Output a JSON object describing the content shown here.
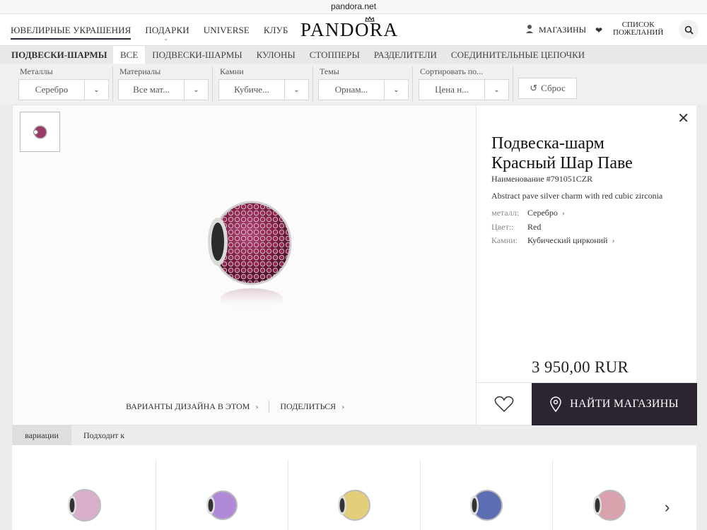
{
  "browser": {
    "url": "pandora.net"
  },
  "header": {
    "nav": [
      {
        "label": "ЮВЕЛИРНЫЕ УКРАШЕНИЯ"
      },
      {
        "label": "ПОДАРКИ"
      },
      {
        "label": "UNIVERSE"
      },
      {
        "label": "КЛУБ"
      }
    ],
    "logo": "PANDORA",
    "stores_label": "МАГАЗИНЫ",
    "wishlist_line1": "СПИСОК",
    "wishlist_line2": "ПОЖЕЛАНИЙ"
  },
  "category": {
    "title": "ПОДВЕСКИ-ШАРМЫ",
    "tabs": [
      {
        "label": "ВСЕ"
      },
      {
        "label": "ПОДВЕСКИ-ШАРМЫ"
      },
      {
        "label": "КУЛОНЫ"
      },
      {
        "label": "СТОППЕРЫ"
      },
      {
        "label": "РАЗДЕЛИТЕЛИ"
      },
      {
        "label": "СОЕДИНИТЕЛЬНЫЕ ЦЕПОЧКИ"
      }
    ]
  },
  "filters": [
    {
      "label": "Металлы",
      "value": "Серебро"
    },
    {
      "label": "Материалы",
      "value": "Все мат..."
    },
    {
      "label": "Камни",
      "value": "Кубиче..."
    },
    {
      "label": "Темы",
      "value": "Орнам..."
    },
    {
      "label": "Сортировать по...",
      "value": "Цена н..."
    }
  ],
  "reset_label": "Сброс",
  "product": {
    "title": "Подвеска-шарм Красный Шар Паве",
    "sku": "Наименование #791051CZR",
    "description": "Abstract pave silver charm with red cubic zirconia",
    "attributes": [
      {
        "key": "металл:",
        "value": "Серебро",
        "link": true
      },
      {
        "key": "Цвет::",
        "value": "Red",
        "link": false
      },
      {
        "key": "Камни:",
        "value": "Кубический цирконий",
        "link": true
      }
    ],
    "price": "3 950,00 RUR",
    "find_stores_label": "НАЙТИ МАГАЗИНЫ",
    "design_variants_label": "ВАРИАНТЫ ДИЗАЙНА В ЭТОМ",
    "share_label": "ПОДЕЛИТЬСЯ"
  },
  "variation_tabs": [
    {
      "label": "вариации"
    },
    {
      "label": "Подходит к"
    }
  ],
  "variations": [
    {
      "color": "#d8b0cc"
    },
    {
      "color": "#b08ad6"
    },
    {
      "color": "#e3cf7a"
    },
    {
      "color": "#5d6db4"
    },
    {
      "color": "#d9a2ad"
    }
  ],
  "colors": {
    "brand_dark": "#2c2430",
    "charm_stone": "#8a2350"
  }
}
